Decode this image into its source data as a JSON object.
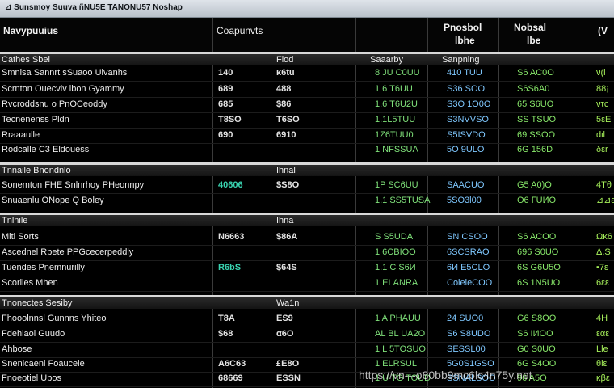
{
  "window": {
    "title": "⊿ Sunsmoy Suuva ñNU5E TANONU57 Noshap",
    "title_tag": "TANONU57"
  },
  "header": {
    "col1": "Navypuuius",
    "col2": "Coapunvts",
    "col4a": "Pnosbol",
    "col4b": "lbhe",
    "col5a": "Nobsal",
    "col5b": "lbe",
    "col6": "(V"
  },
  "sections": [
    {
      "label": "Cathes Sbel",
      "col_b": "Flod",
      "col_c": "Saaarby",
      "col_d": "Sanpnlng",
      "rows": [
        {
          "name": "Smnisa Sannrt sSuaoo Ulvanhs",
          "a": "140",
          "b": "κ6tu",
          "c": "8 JU C0UU",
          "d": "410 TUU",
          "e": "S6 AC0O",
          "f": "ν(l"
        },
        {
          "name": "Scrnton Ouecvlv lbon Gyammy",
          "a": "689",
          "b": "488",
          "c": "1 6 T6UU",
          "d": "S36 SOO",
          "e": "S6S6A0",
          "f": "88¡"
        },
        {
          "name": "Rvcroddsnu o PnOCeoddy",
          "a": "685",
          "b": "$86",
          "c": "1.6 T6U2U",
          "d": "S3O 1O0O",
          "e": "65 S6UO",
          "f": "ντc"
        },
        {
          "name": "Tecnenenss Pldn",
          "a": "T8SO",
          "b": "T6SO",
          "c": "1.1L5TUU",
          "d": "S3NVVSO",
          "e": "SS TSUO",
          "f": "5εΕ"
        },
        {
          "name": "Rraaaulle",
          "a": "690",
          "b": "6910",
          "c": "1Z6TUU0",
          "d": "S5ISVDO",
          "e": "69 SSOO",
          "f": "dιl"
        },
        {
          "name": "Rodcalle C3 Eldouess",
          "a": "",
          "b": "",
          "c": "1 NFSSUA",
          "d": "5O 9ULO",
          "e": "6G 156D",
          "f": "δεr"
        }
      ]
    },
    {
      "label": "Tnnaile Bnondnlo",
      "col_b": "Ihnal",
      "rows": [
        {
          "name": "Sonemton FHE Snlnrhoy PHeonnpy",
          "a": "40606",
          "b": "$S8O",
          "c": "1P SC6UU",
          "d": "SAACUO",
          "e": "G5 A0)O",
          "f": "4Тθ"
        },
        {
          "name": "Snuaenlu ONope Q Boley",
          "a": "",
          "b": "",
          "c": "1.1 SS5TUSA",
          "d": "5SO3l00",
          "e": "O6 ГUИO",
          "f": "⊿⊿ε"
        }
      ]
    },
    {
      "label": "Tnlnile",
      "col_b": "Ihna",
      "rows": [
        {
          "name": "Mitl Sorts",
          "a": "N6663",
          "b": "$86A",
          "c": "S S5UDA",
          "d": "SN CSOO",
          "e": "S6 ACOO",
          "f": "Ωκ6"
        },
        {
          "name": "Ascednel Rbete PPGcecerpeddly",
          "a": "",
          "b": "",
          "c": "1 6CBIOO",
          "d": "6SCSRAO",
          "e": "696 S0UO",
          "f": "Δ.S"
        },
        {
          "name": "Tuendes Pnemnurilly",
          "a": "R6bS",
          "b": "$64S",
          "c": "1.1 C S6И",
          "d": "6И E5CLO",
          "e": "6S G6U5O",
          "f": "▪7ε"
        },
        {
          "name": "Scorlles Mhen",
          "a": "",
          "b": "",
          "c": "1 ELANRA",
          "d": "ColeleCOO",
          "e": "6S 1N5UO",
          "f": "6εε"
        }
      ]
    },
    {
      "label": "Tnonectes Sesiby",
      "col_b": "Wa1n",
      "rows": [
        {
          "name": "Fhooolnnsl Gunnns Yhiteo",
          "a": "T8A",
          "b": "ES9",
          "c": "1 A PHAUU",
          "d": "24 SUO0",
          "e": "G6 S8OO",
          "f": "4H"
        },
        {
          "name": "Fdehlaol Guudo",
          "a": "$68",
          "b": "α6O",
          "c": "AL BL UA2O",
          "d": "S6 S8UDO",
          "e": "S6 IИOO",
          "f": "εαε"
        },
        {
          "name": "Ahbose",
          "a": "",
          "b": "",
          "c": "1 L 5TOSUO",
          "d": "SESSL00",
          "e": "G0 S0UO",
          "f": "Llе"
        },
        {
          "name": "Snenicaenl Foaucele",
          "a": "A6C63",
          "b": "£E8O",
          "c": "1 ELRSUL",
          "d": "5G0S1GSO",
          "e": "6G S4OO",
          "f": "θlε"
        },
        {
          "name": "Fnoeotiel Ubos",
          "a": "68669",
          "b": "ESSN",
          "c": "1.U TG TOUD",
          "d": "SSNALSOO",
          "e": "96 A5O",
          "f": "κβε"
        }
      ]
    }
  ],
  "watermark": "https://vn---o80bb9mc6lc4n75y.net"
}
